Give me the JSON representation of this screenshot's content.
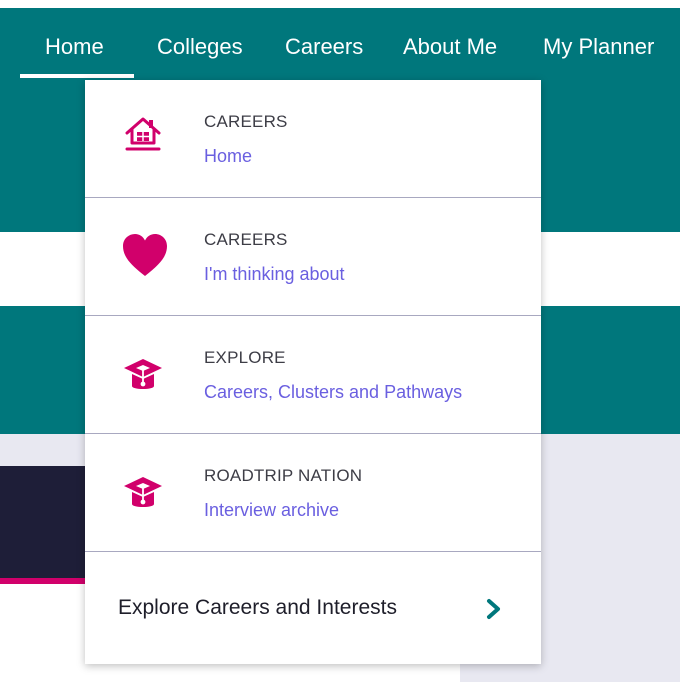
{
  "nav": {
    "items": [
      {
        "label": "Home"
      },
      {
        "label": "Colleges"
      },
      {
        "label": "Careers"
      },
      {
        "label": "About Me"
      },
      {
        "label": "My Planner"
      }
    ]
  },
  "dropdown": {
    "items": [
      {
        "title": "CAREERS",
        "link": "Home",
        "icon": "house-icon"
      },
      {
        "title": "CAREERS",
        "link": "I'm thinking about",
        "icon": "heart-icon"
      },
      {
        "title": "EXPLORE",
        "link": "Careers, Clusters and Pathways",
        "icon": "graduation-cap-icon"
      },
      {
        "title": "ROADTRIP NATION",
        "link": "Interview archive",
        "icon": "graduation-cap-icon"
      }
    ],
    "footer": {
      "label": "Explore Careers and Interests",
      "icon": "chevron-right-icon"
    }
  },
  "colors": {
    "nav_background": "#00777c",
    "icon_accent": "#d1006b",
    "link": "#6a5fe0",
    "chevron": "#00777c"
  }
}
